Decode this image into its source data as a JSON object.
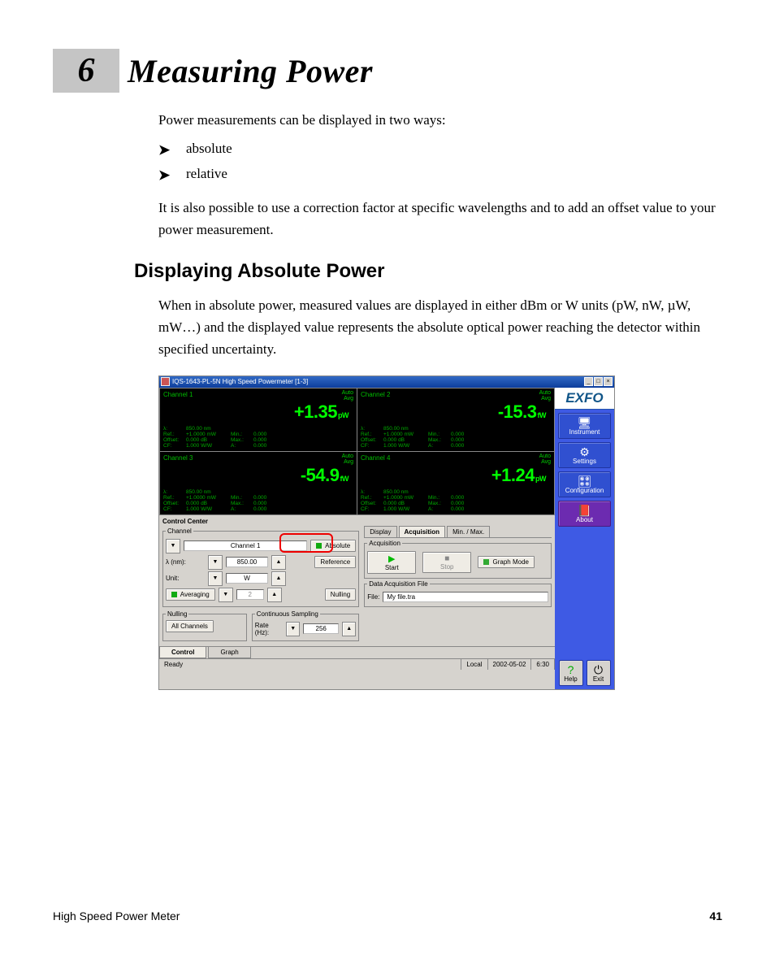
{
  "chapter": {
    "number": "6",
    "title": "Measuring Power"
  },
  "body": {
    "intro": "Power measurements can be displayed in two ways:",
    "bullets": [
      "absolute",
      "relative"
    ],
    "para2": "It is also possible to use a correction factor at specific wavelengths and to add an offset value to your power measurement."
  },
  "section": {
    "heading": "Displaying Absolute Power",
    "para": "When in absolute power, measured values are displayed in either dBm or W units (pW, nW, µW, mW…) and the displayed value represents the absolute optical power reaching the detector within specified uncertainty."
  },
  "shot": {
    "titlebar": "IQS-1643-PL-5N High Speed Powermeter [1-3]",
    "auto": "Auto",
    "avg": "Avg",
    "channels": [
      {
        "name": "Channel 1",
        "value": "+1.35",
        "unit": "pW"
      },
      {
        "name": "Channel 2",
        "value": "-15.3",
        "unit": "fW"
      },
      {
        "name": "Channel 3",
        "value": "-54.9",
        "unit": "fW"
      },
      {
        "name": "Channel 4",
        "value": "+1.24",
        "unit": "pW"
      }
    ],
    "ch_rows": {
      "lambda": "λ:",
      "lambda_v": "850.00  nm",
      "ref": "Ref.:",
      "ref_v": "+1.0000  mW",
      "min": "Min.:",
      "min_v": "0.000",
      "off": "Offset:",
      "off_v": "0.000  dB",
      "max": "Max.:",
      "max_v": "0.000",
      "cf": "CF:",
      "cf_v": "1.000  W/W",
      "a": "A:",
      "a_v": "0.000"
    },
    "cc_title": "Control Center",
    "channel_panel": {
      "legend": "Channel",
      "selected": "Channel 1",
      "absolute": "Absolute",
      "lambda_label": "λ  (nm):",
      "lambda_value": "850.00",
      "unit_label": "Unit:",
      "unit_value": "W",
      "reference": "Reference",
      "averaging": "Averaging",
      "avg_value": "2",
      "nulling_btn": "Nulling"
    },
    "nulling_panel": {
      "legend": "Nulling",
      "all": "All Channels"
    },
    "sampling_panel": {
      "legend": "Continuous Sampling",
      "rate_label": "Rate (Hz):",
      "rate_value": "256"
    },
    "tabs": {
      "display": "Display",
      "acq": "Acquisition",
      "minmax": "Min. / Max."
    },
    "acq_panel": {
      "legend": "Acquisition",
      "start": "Start",
      "stop": "Stop",
      "graph": "Graph Mode"
    },
    "file_panel": {
      "legend": "Data Acquisition File",
      "file_label": "File:",
      "file_value": "My file.tra"
    },
    "bottom_tabs": {
      "control": "Control",
      "graph": "Graph"
    },
    "sidebar": {
      "logo": "EXFO",
      "instrument": "Instrument",
      "settings": "Settings",
      "config": "Configuration",
      "about": "About",
      "help": "Help",
      "exit": "Exit"
    },
    "statusbar": {
      "ready": "Ready",
      "local": "Local",
      "date": "2002-05-02",
      "time": "6:30"
    }
  },
  "footer": {
    "left": "High Speed Power Meter",
    "page": "41"
  }
}
